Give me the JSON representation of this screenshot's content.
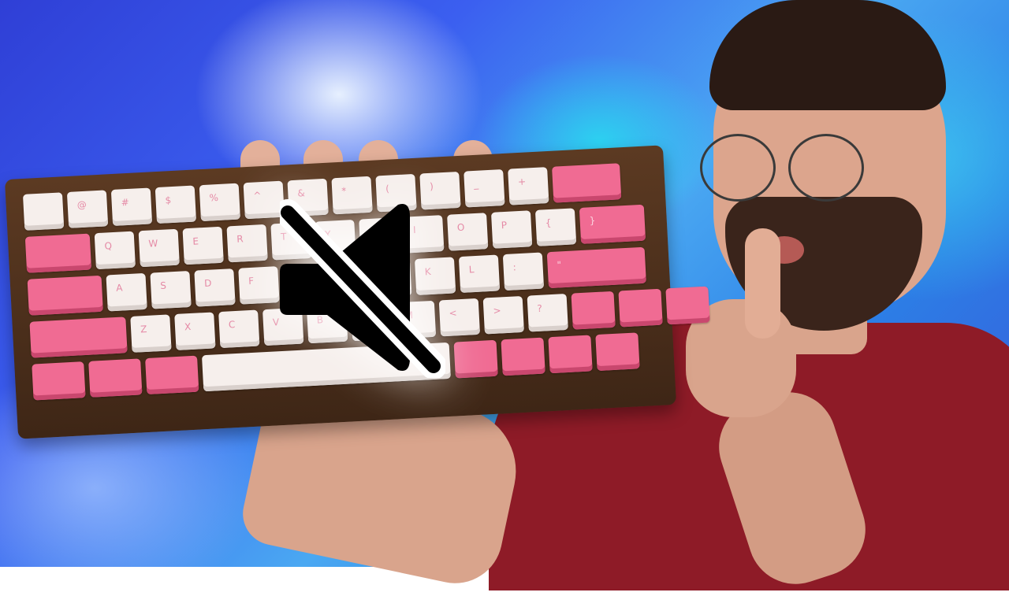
{
  "scene": {
    "subject": "",
    "accent_colors": {
      "shirt": "#8e1b27",
      "keycap_pink": "#f06b93",
      "keycap_white": "#f6efec",
      "case_wood": "#5c3a22"
    }
  },
  "keyboard": {
    "rows": [
      [
        "",
        "@",
        "#",
        "$",
        "%",
        "^",
        "&",
        "*",
        "(",
        ")",
        "_",
        "+",
        ""
      ],
      [
        "Q",
        "W",
        "E",
        "R",
        "T",
        "Y",
        "U",
        "I",
        "O",
        "P",
        "{",
        "}",
        "|"
      ],
      [
        "A",
        "S",
        "D",
        "F",
        "G",
        "H",
        "J",
        "K",
        "L",
        ":",
        "\"",
        ""
      ],
      [
        "Z",
        "X",
        "C",
        "V",
        "B",
        "N",
        "M",
        "<",
        ">",
        "?",
        ""
      ],
      [
        "",
        "",
        "",
        "",
        "",
        "",
        "",
        ""
      ]
    ]
  },
  "icons": {
    "overlay": "speaker-muted-icon",
    "escape_key": "cat-paw-icon"
  }
}
